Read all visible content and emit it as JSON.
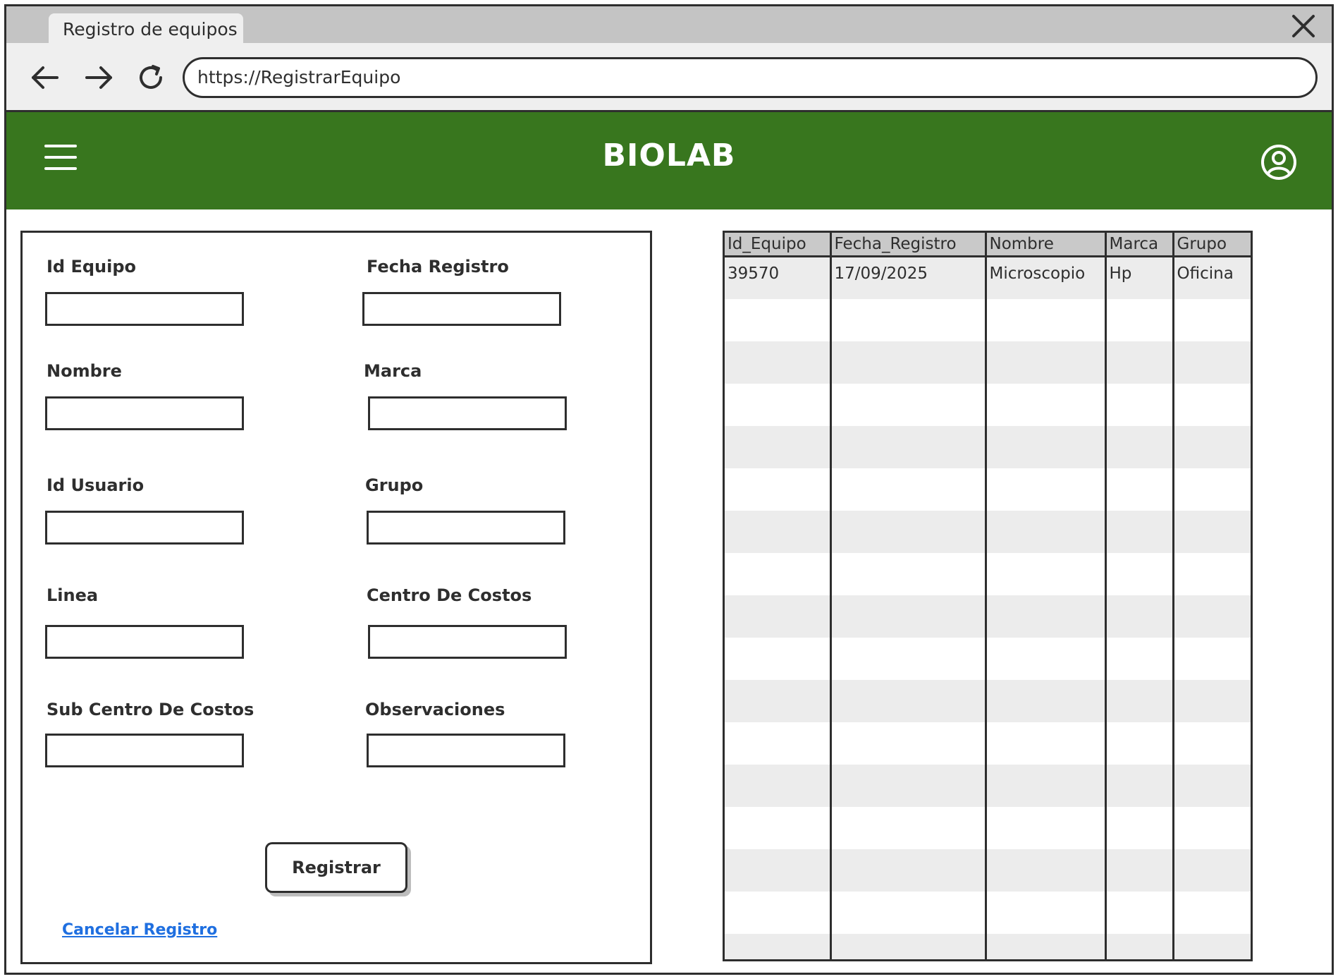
{
  "browser": {
    "tab_title": "Registro de equipos",
    "url": "https://RegistrarEquipo",
    "icons": {
      "back": "arrow-left-icon",
      "forward": "arrow-right-icon",
      "reload": "reload-icon",
      "close": "close-icon"
    }
  },
  "header": {
    "title": "BIOLAB",
    "background_color": "#38761e",
    "menu_icon": "hamburger-menu-icon",
    "user_icon": "user-account-icon"
  },
  "form": {
    "fields": [
      {
        "label": "Id Equipo",
        "value": ""
      },
      {
        "label": "Fecha Registro",
        "value": ""
      },
      {
        "label": "Nombre",
        "value": ""
      },
      {
        "label": "Marca",
        "value": ""
      },
      {
        "label": "Id Usuario",
        "value": ""
      },
      {
        "label": "Grupo",
        "value": ""
      },
      {
        "label": "Linea",
        "value": ""
      },
      {
        "label": "Centro De Costos",
        "value": ""
      },
      {
        "label": "Sub Centro De Costos",
        "value": ""
      },
      {
        "label": "Observaciones",
        "value": ""
      }
    ],
    "submit_label": "Registrar",
    "cancel_label": "Cancelar Registro",
    "link_color": "#1f6fe0"
  },
  "table": {
    "columns": [
      "Id_Equipo",
      "Fecha_Registro",
      "Nombre",
      "Marca",
      "Grupo"
    ],
    "rows": [
      [
        "39570",
        "17/09/2025",
        "Microscopio",
        "Hp",
        "Oficina"
      ],
      [
        "",
        "",
        "",
        "",
        ""
      ],
      [
        "",
        "",
        "",
        "",
        ""
      ],
      [
        "",
        "",
        "",
        "",
        ""
      ],
      [
        "",
        "",
        "",
        "",
        ""
      ],
      [
        "",
        "",
        "",
        "",
        ""
      ],
      [
        "",
        "",
        "",
        "",
        ""
      ],
      [
        "",
        "",
        "",
        "",
        ""
      ],
      [
        "",
        "",
        "",
        "",
        ""
      ],
      [
        "",
        "",
        "",
        "",
        ""
      ],
      [
        "",
        "",
        "",
        "",
        ""
      ],
      [
        "",
        "",
        "",
        "",
        ""
      ],
      [
        "",
        "",
        "",
        "",
        ""
      ],
      [
        "",
        "",
        "",
        "",
        ""
      ],
      [
        "",
        "",
        "",
        "",
        ""
      ],
      [
        "",
        "",
        "",
        "",
        ""
      ],
      [
        "",
        "",
        "",
        "",
        ""
      ]
    ],
    "stripe_color": "#ececec",
    "header_color": "#c9c9c9"
  }
}
